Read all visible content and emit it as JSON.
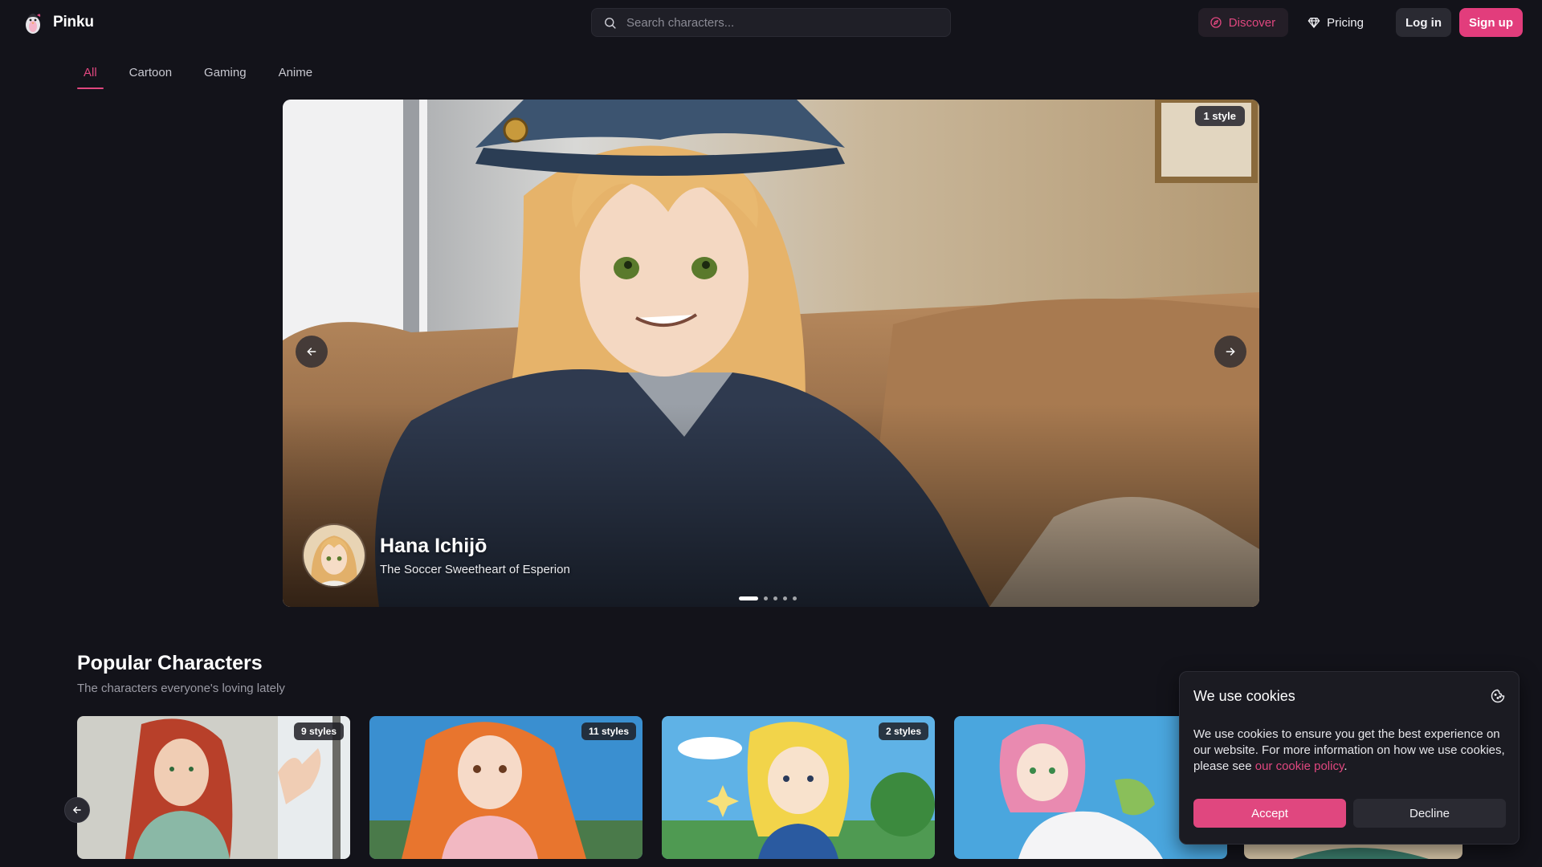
{
  "brand": {
    "name": "Pinku"
  },
  "search": {
    "placeholder": "Search characters..."
  },
  "nav": {
    "discover": "Discover",
    "pricing": "Pricing",
    "login": "Log in",
    "signup": "Sign up"
  },
  "tabs": [
    {
      "label": "All",
      "active": true
    },
    {
      "label": "Cartoon",
      "active": false
    },
    {
      "label": "Gaming",
      "active": false
    },
    {
      "label": "Anime",
      "active": false
    }
  ],
  "hero": {
    "badge": "1 style",
    "name": "Hana Ichijō",
    "subtitle": "The Soccer Sweetheart of Esperion",
    "slide_count": 5,
    "active_slide": 1
  },
  "popular": {
    "title": "Popular Characters",
    "subtitle": "The characters everyone's loving lately",
    "cards": [
      {
        "badge": "9 styles"
      },
      {
        "badge": "11 styles"
      },
      {
        "badge": "2 styles"
      },
      {
        "badge": ""
      }
    ]
  },
  "cookie": {
    "title": "We use cookies",
    "text": "We use cookies to ensure you get the best experience on our website. For more information on how we use cookies, please see ",
    "link": "our cookie policy",
    "end": ".",
    "accept": "Accept",
    "decline": "Decline"
  },
  "colors": {
    "accent": "#e0477f",
    "background": "#13131a",
    "surface": "#1b1b22"
  },
  "icons": [
    "pinku-logo-icon",
    "search-icon",
    "discover-compass-icon",
    "diamond-icon",
    "arrow-left-icon",
    "arrow-right-icon",
    "cookie-icon"
  ]
}
